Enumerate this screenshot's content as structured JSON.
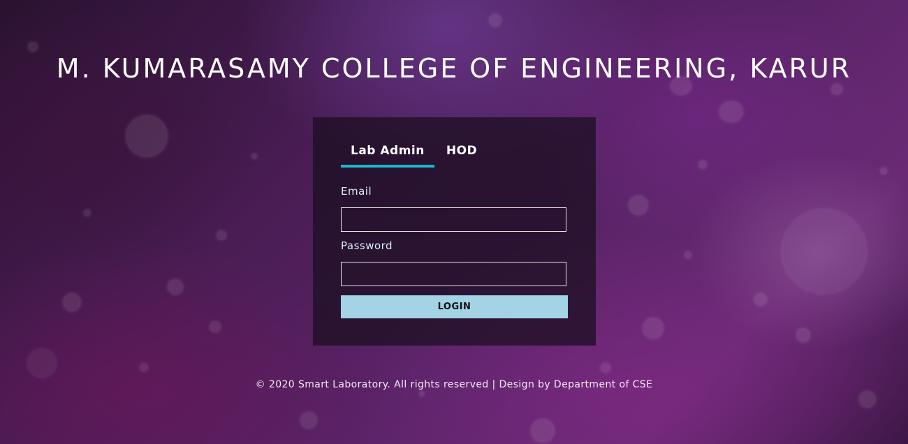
{
  "header": {
    "title": "M. KUMARASAMY COLLEGE OF ENGINEERING, KARUR"
  },
  "login": {
    "tabs": [
      {
        "label": "Lab Admin",
        "active": true
      },
      {
        "label": "HOD",
        "active": false
      }
    ],
    "email_label": "Email",
    "email_value": "",
    "password_label": "Password",
    "password_value": "",
    "login_button": "LOGIN"
  },
  "footer": {
    "text": "© 2020 Smart Laboratory. All rights reserved | Design by Department of CSE"
  },
  "colors": {
    "tab_accent": "#1fb5cf",
    "button_bg": "#a3d3e4",
    "card_bg": "#190e1e"
  }
}
